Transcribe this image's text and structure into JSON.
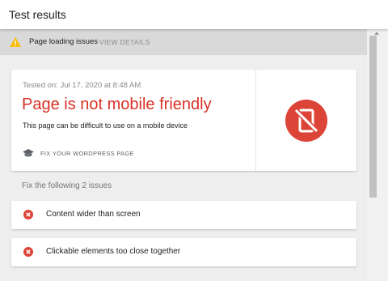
{
  "header": {
    "title": "Test results"
  },
  "warning": {
    "icon": "warning-triangle-icon",
    "text": "Page loading issues",
    "link": "VIEW DETAILS",
    "color": "#fbbc04"
  },
  "result": {
    "tested_on": "Tested on: Jul 17, 2020 at 8:48 AM",
    "verdict": "Page is not mobile friendly",
    "description": "This page can be difficult to use on a mobile device",
    "fix_link": "FIX YOUR WORDPRESS PAGE",
    "fix_icon": "graduation-cap-icon",
    "status_icon": "mobile-off-icon",
    "status_color": "#db4437"
  },
  "issues": {
    "title": "Fix the following 2 issues",
    "items": [
      {
        "label": "Content wider than screen",
        "icon": "error-circle-icon"
      },
      {
        "label": "Clickable elements too close together",
        "icon": "error-circle-icon"
      }
    ]
  }
}
